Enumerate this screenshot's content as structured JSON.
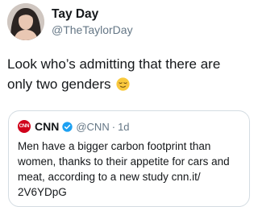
{
  "tweet": {
    "author_name": "Tay Day",
    "author_handle": "@TheTaylorDay",
    "text": "Look who’s admitting that there are only two genders",
    "emoji": "relieved-face-emoji"
  },
  "quoted_tweet": {
    "logo_text": "CNN",
    "author_name": "CNN",
    "verified": true,
    "author_handle": "@CNN",
    "separator": "·",
    "time": "1d",
    "text": "Men have a bigger carbon footprint than women, thanks to their appetite for cars and meat, according to a new study cnn.it/​2V6YDpG"
  },
  "colors": {
    "text_primary": "#14171a",
    "text_secondary": "#657786",
    "verified_blue": "#1da1f2",
    "cnn_red": "#d0021b",
    "card_border": "#d4dce2"
  }
}
